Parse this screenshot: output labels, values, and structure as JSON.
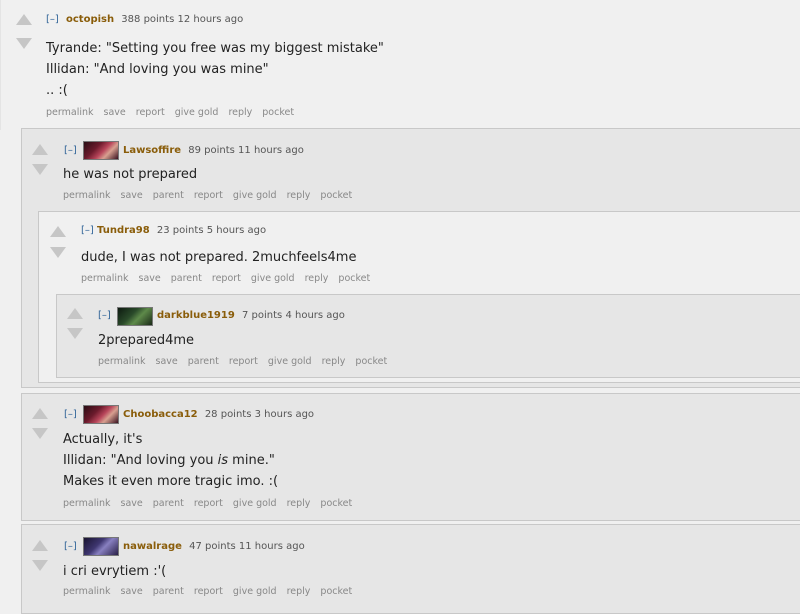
{
  "comments": [
    {
      "toggle": "[–]",
      "author": "octopish",
      "points": "388 points",
      "time": "12 hours ago",
      "lines": [
        "Tyrande: \"Setting you free was my biggest mistake\"",
        "Illidan: \"And loving you was mine\"",
        ".. :("
      ],
      "actions": [
        "permalink",
        "save",
        "report",
        "give gold",
        "reply",
        "pocket"
      ]
    },
    {
      "toggle": "[–]",
      "author": "Lawsoffire",
      "points": "89 points",
      "time": "11 hours ago",
      "lines": [
        "he was not prepared"
      ],
      "actions": [
        "permalink",
        "save",
        "parent",
        "report",
        "give gold",
        "reply",
        "pocket"
      ]
    },
    {
      "toggle": "[–]",
      "author": "Tundra98",
      "points": "23 points",
      "time": "5 hours ago",
      "lines": [
        "dude, I was not prepared. 2muchfeels4me"
      ],
      "actions": [
        "permalink",
        "save",
        "parent",
        "report",
        "give gold",
        "reply",
        "pocket"
      ]
    },
    {
      "toggle": "[–]",
      "author": "darkblue1919",
      "points": "7 points",
      "time": "4 hours ago",
      "lines": [
        "2prepared4me"
      ],
      "actions": [
        "permalink",
        "save",
        "parent",
        "report",
        "give gold",
        "reply",
        "pocket"
      ]
    },
    {
      "toggle": "[–]",
      "author": "Choobacca12",
      "points": "28 points",
      "time": "3 hours ago",
      "lines": [
        "Actually, it's"
      ],
      "line2": {
        "before": "Illidan: \"And loving you ",
        "em": "is",
        "after": " mine.\""
      },
      "line3": "Makes it even more tragic imo. :(",
      "actions": [
        "permalink",
        "save",
        "parent",
        "report",
        "give gold",
        "reply",
        "pocket"
      ]
    },
    {
      "toggle": "[–]",
      "author": "nawalrage",
      "points": "47 points",
      "time": "11 hours ago",
      "lines": [
        "i cri evrytiem :'("
      ],
      "actions": [
        "permalink",
        "save",
        "parent",
        "report",
        "give gold",
        "reply",
        "pocket"
      ]
    }
  ],
  "colors": {
    "author": "#8a5d0a",
    "toggle": "#336699",
    "arrow": "#c6c6c6"
  },
  "icons": {
    "upvote": "up-arrow-icon",
    "downvote": "down-arrow-icon"
  }
}
